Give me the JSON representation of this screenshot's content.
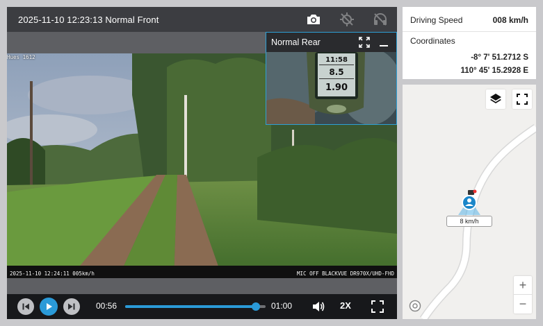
{
  "video": {
    "title": "2025-11-10 12:23:13 Normal Front",
    "osd_top": "Hues 1612",
    "osd_bottom_left": "2025-11-10 12:24:11 005km/h",
    "osd_bottom_right": "MIC OFF BLACKVUE DR970X/UHD-FHD",
    "header_icons": [
      "camera-icon",
      "gps-off-icon",
      "headset-icon"
    ]
  },
  "rear": {
    "title": "Normal Rear",
    "device_readings": [
      "11:58",
      "8.5",
      "1.90"
    ]
  },
  "controls": {
    "current_time": "00:56",
    "end_time": "01:00",
    "progress": 0.93,
    "speed": "2X"
  },
  "info": {
    "speed_label": "Driving Speed",
    "speed_value": "008 km/h",
    "coord_label": "Coordinates",
    "latitude": "-8° 7' 51.2712 S",
    "longitude": "110° 45' 15.2928 E"
  },
  "map": {
    "vehicle_speed": "8 km/h",
    "zoom_in": "+",
    "zoom_out": "−"
  },
  "colors": {
    "accent": "#2a9ad8",
    "header_bg": "#3c3d41",
    "controls_bg": "#17181b"
  }
}
